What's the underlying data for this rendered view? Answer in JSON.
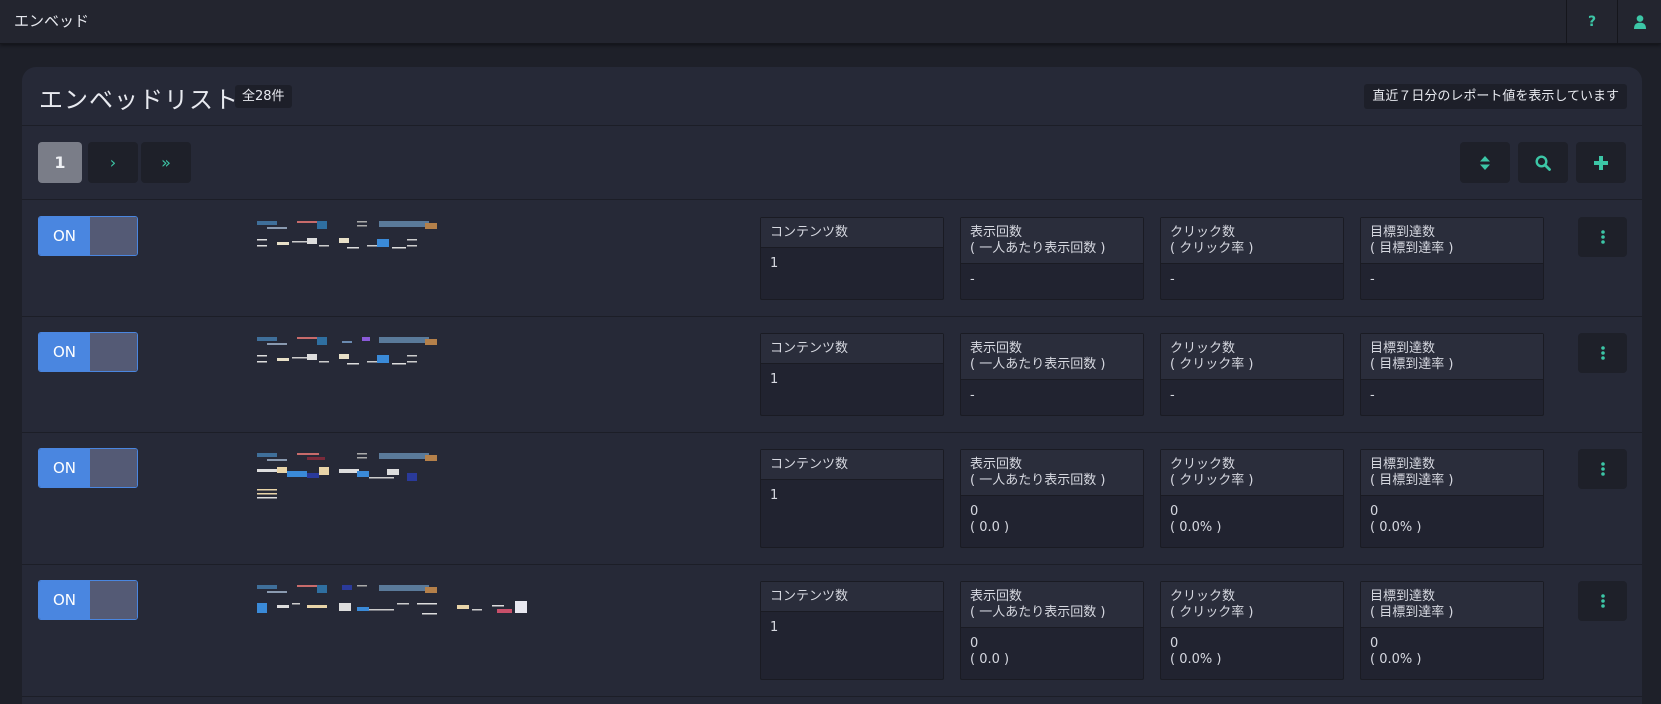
{
  "header": {
    "title": "エンベッド",
    "help_icon": "question-icon",
    "user_icon": "user-icon"
  },
  "panel": {
    "title": "エンベッドリスト",
    "total": "全28件",
    "report_note": "直近７日分のレポート値を表示しています"
  },
  "pagination": {
    "current": "1",
    "next": "›",
    "last": "»"
  },
  "toolbar": {
    "sort_icon": "sort-icon",
    "search_icon": "search-icon",
    "add_icon": "plus-icon"
  },
  "colors": {
    "accent": "#3cc6a6",
    "toggle_on": "#4a86e0",
    "toggle_off": "#545a75"
  },
  "rows": [
    {
      "toggle": "ON",
      "contents_label": "コンテンツ数",
      "contents_value": "1",
      "imp_label": "表示回数",
      "imp_sub": "( 一人あたり表示回数 )",
      "imp_value": "-",
      "imp_value2": "",
      "click_label": "クリック数",
      "click_sub": "( クリック率 )",
      "click_value": "-",
      "click_value2": "",
      "goal_label": "目標到達数",
      "goal_sub": "( 目標到達率 )",
      "goal_value": "-",
      "goal_value2": ""
    },
    {
      "toggle": "ON",
      "contents_label": "コンテンツ数",
      "contents_value": "1",
      "imp_label": "表示回数",
      "imp_sub": "( 一人あたり表示回数 )",
      "imp_value": "-",
      "imp_value2": "",
      "click_label": "クリック数",
      "click_sub": "( クリック率 )",
      "click_value": "-",
      "click_value2": "",
      "goal_label": "目標到達数",
      "goal_sub": "( 目標到達率 )",
      "goal_value": "-",
      "goal_value2": ""
    },
    {
      "toggle": "ON",
      "contents_label": "コンテンツ数",
      "contents_value": "1",
      "imp_label": "表示回数",
      "imp_sub": "( 一人あたり表示回数 )",
      "imp_value": "0",
      "imp_value2": "( 0.0 )",
      "click_label": "クリック数",
      "click_sub": "( クリック率 )",
      "click_value": "0",
      "click_value2": "( 0.0% )",
      "goal_label": "目標到達数",
      "goal_sub": "( 目標到達率 )",
      "goal_value": "0",
      "goal_value2": "( 0.0% )"
    },
    {
      "toggle": "ON",
      "contents_label": "コンテンツ数",
      "contents_value": "1",
      "imp_label": "表示回数",
      "imp_sub": "( 一人あたり表示回数 )",
      "imp_value": "0",
      "imp_value2": "( 0.0 )",
      "click_label": "クリック数",
      "click_sub": "( クリック率 )",
      "click_value": "0",
      "click_value2": "( 0.0% )",
      "goal_label": "目標到達数",
      "goal_sub": "( 目標到達率 )",
      "goal_value": "0",
      "goal_value2": "( 0.0% )"
    }
  ]
}
